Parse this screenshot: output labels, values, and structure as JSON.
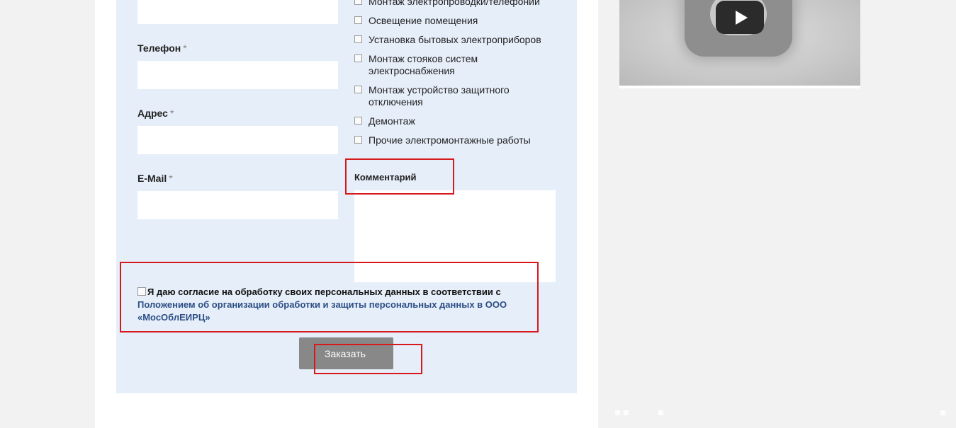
{
  "form": {
    "phone_label": "Телефон",
    "address_label": "Адрес",
    "email_label": "E-Mail",
    "required_mark": "*",
    "comment_label": "Комментарий",
    "services": [
      "Монтаж электропроводки/телефонии",
      "Освещение помещения",
      "Установка бытовых электроприборов",
      "Монтаж стояков систем электроснабжения",
      "Монтаж устройство защитного отключения",
      "Демонтаж",
      "Прочие электромонтажные работы"
    ],
    "consent_text": "Я даю согласие на обработку своих персональных данных в соответствии с",
    "consent_link": "Положением об организации обработки и защиты персональных данных в ООО «МосОблЕИРЦ»",
    "submit_label": "Заказать"
  },
  "video": {
    "play_icon": "play-icon"
  },
  "colors": {
    "panel_bg": "#e6eef9",
    "link": "#2c4e85",
    "button": "#888888",
    "annotation": "#d7191c"
  }
}
